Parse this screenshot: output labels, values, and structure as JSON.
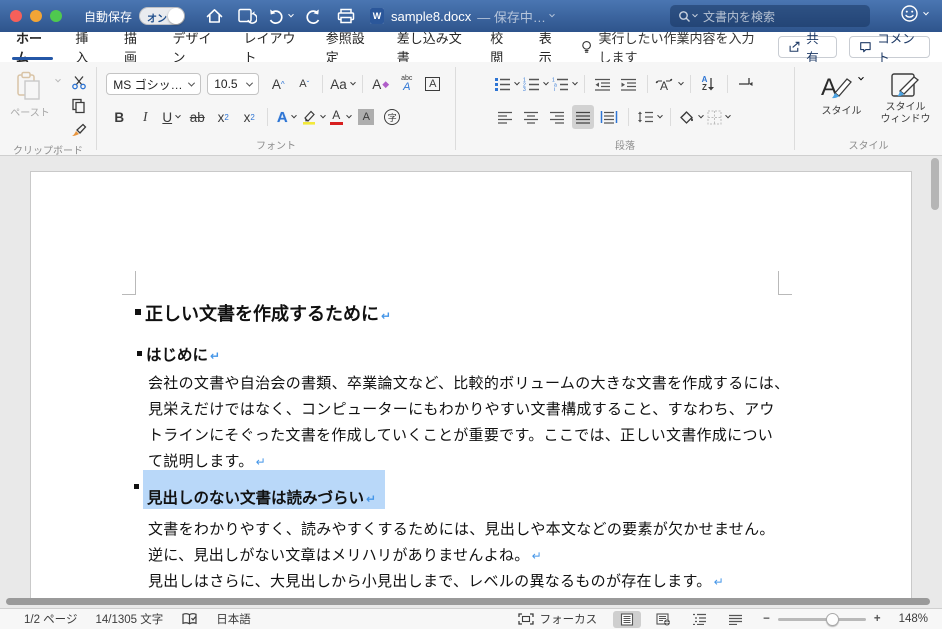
{
  "titlebar": {
    "autosave_label": "自動保存",
    "autosave_state": "オン",
    "doc_title": "sample8.docx",
    "doc_status": "— 保存中…",
    "search_placeholder": "文書内を検索"
  },
  "tabs": {
    "items": [
      "ホーム",
      "挿入",
      "描画",
      "デザイン",
      "レイアウト",
      "参照設定",
      "差し込み文書",
      "校閲",
      "表示"
    ],
    "tell_me": "実行したい作業内容を入力します",
    "share_label": "共有",
    "comment_label": "コメント"
  },
  "ribbon": {
    "paste_label": "ペースト",
    "group_clipboard": "クリップボード",
    "group_font": "フォント",
    "group_paragraph": "段落",
    "group_styles": "スタイル",
    "font_name": "MS ゴシッ…",
    "font_size": "10.5",
    "bold": "B",
    "italic": "I",
    "underline": "U",
    "strike": "ab",
    "subscript_base": "x",
    "subscript_mark": "2",
    "superscript_base": "x",
    "superscript_mark": "2",
    "grow_font": "A",
    "shrink_font": "A",
    "change_case": "Aa",
    "clear_format": "A",
    "ruby_top": "abc",
    "ruby_base": "A",
    "enclose_a": "A",
    "text_effects": "A",
    "font_color": "A",
    "char_shading": "A",
    "enclose_char": "字",
    "sort_a": "A",
    "sort_z": "Z",
    "style_label": "スタイル",
    "style_window_line1": "スタイル",
    "style_window_line2": "ウィンドウ"
  },
  "document": {
    "h1": "正しい文書を作成するために",
    "h2": "はじめに",
    "para1": [
      "会社の文書や自治会の書類、卒業論文など、比較的ボリュームの大きな文書を作成するには、",
      "見栄えだけではなく、コンピューターにもわかりやすい文書構成すること、すなわち、アウ",
      "トラインにそぐった文書を作成していくことが重要です。ここでは、正しい文書作成につい",
      "て説明します。"
    ],
    "h3_selected": "見出しのない文書は読みづらい",
    "para2": [
      "文書をわかりやすく、読みやすくするためには、見出しや本文などの要素が欠かせません。",
      "逆に、見出しがない文章はメリハリがありませんよね。"
    ],
    "para3": [
      "見出しはさらに、大見出しから小見出しまで、レベルの異なるものが存在します。"
    ],
    "return_mark": "↵"
  },
  "statusbar": {
    "page_count": "1/2 ページ",
    "word_count": "14/1305 文字",
    "language": "日本語",
    "focus_label": "フォーカス",
    "zoom_level": "148%"
  },
  "colors": {
    "titlebar_blue": "#3a66a4",
    "accent_blue": "#2e75d4",
    "tab_underline": "#2457a7",
    "selection_highlight": "#b9d8f9",
    "highlight_yellow": "#f3e93a",
    "font_color_red": "#d71f1f"
  }
}
